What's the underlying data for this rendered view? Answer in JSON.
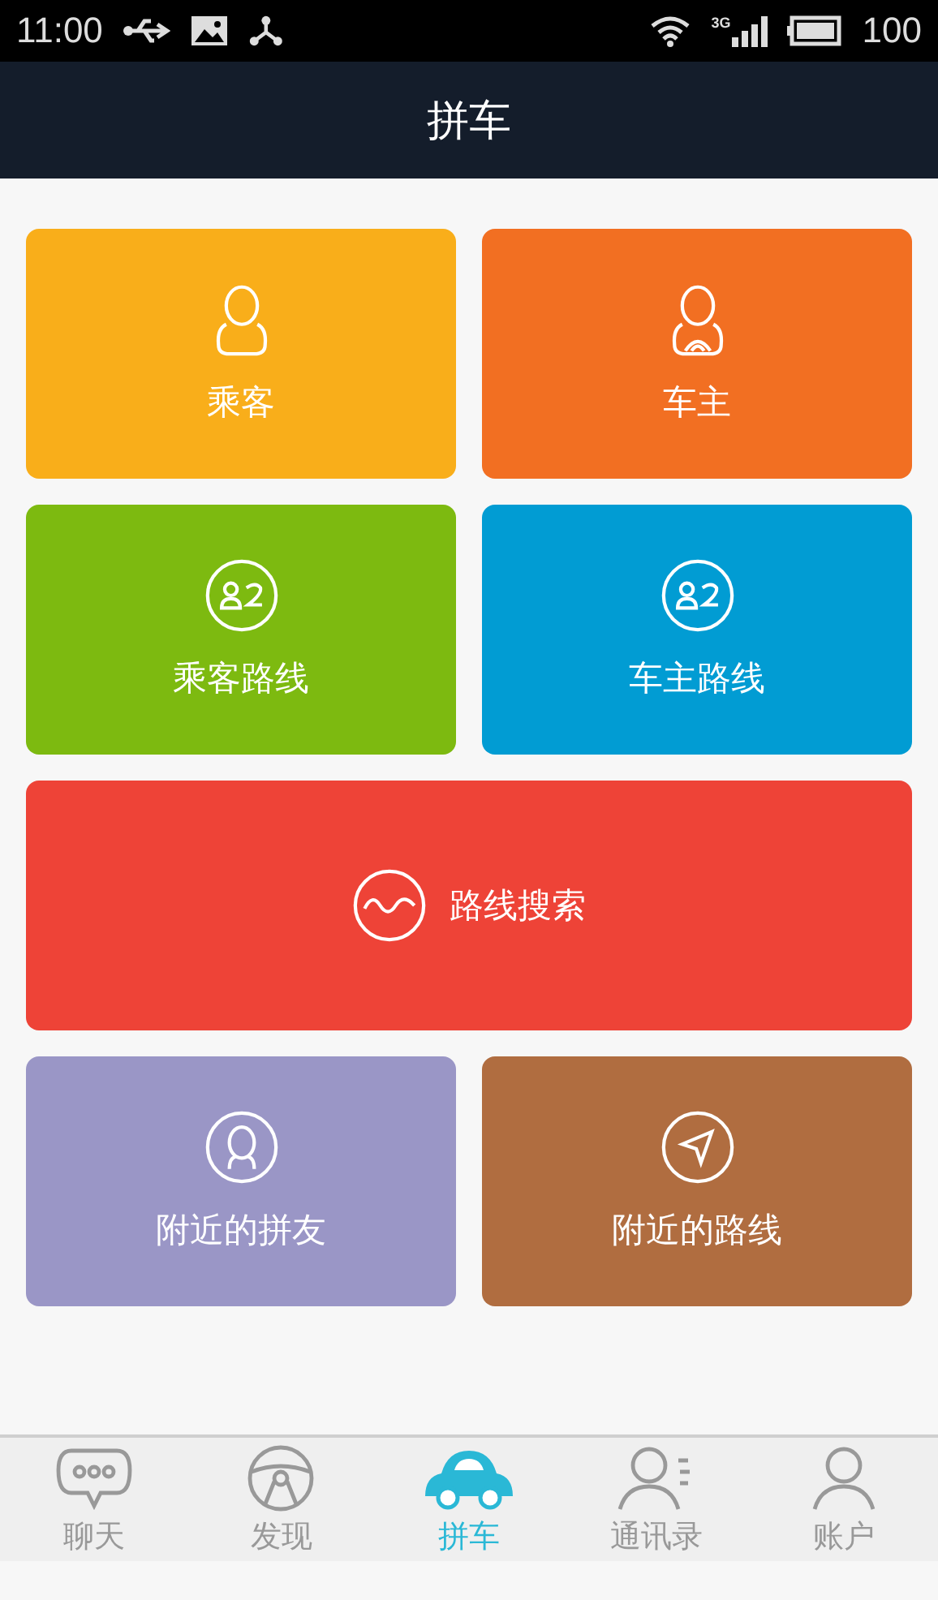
{
  "status_bar": {
    "time": "11:00",
    "battery": "100",
    "network": "3G"
  },
  "header": {
    "title": "拼车"
  },
  "tiles": [
    {
      "label": "乘客",
      "kind": "passenger",
      "color": "#f9ae1a",
      "wide": false
    },
    {
      "label": "车主",
      "kind": "driver",
      "color": "#f26f22",
      "wide": false
    },
    {
      "label": "乘客路线",
      "kind": "route",
      "color": "#7dba10",
      "wide": false
    },
    {
      "label": "车主路线",
      "kind": "route",
      "color": "#019cd3",
      "wide": false
    },
    {
      "label": "路线搜索",
      "kind": "search",
      "color": "#ee4337",
      "wide": true
    },
    {
      "label": "附近的拼友",
      "kind": "nearby",
      "color": "#9a96c6",
      "wide": false
    },
    {
      "label": "附近的路线",
      "kind": "navigate",
      "color": "#b06d40",
      "wide": false
    }
  ],
  "tabs": [
    {
      "label": "聊天",
      "kind": "chat",
      "selected": false
    },
    {
      "label": "发现",
      "kind": "wheel",
      "selected": false
    },
    {
      "label": "拼车",
      "kind": "car",
      "selected": true
    },
    {
      "label": "通讯录",
      "kind": "contacts",
      "selected": false
    },
    {
      "label": "账户",
      "kind": "account",
      "selected": false
    }
  ]
}
